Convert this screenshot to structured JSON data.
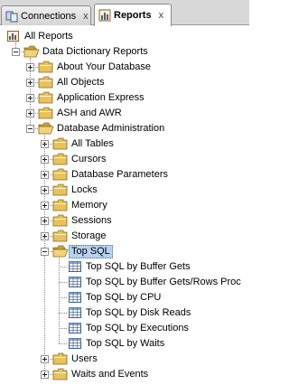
{
  "tabs": [
    {
      "label": "Connections",
      "close": "x",
      "icon": "connections-icon",
      "active": false
    },
    {
      "label": "Reports",
      "close": "x",
      "icon": "reports-icon",
      "active": true
    }
  ],
  "tree": [
    {
      "label": "All Reports",
      "depth": 0,
      "expander": "none",
      "icon": "reports-root-icon"
    },
    {
      "label": "Data Dictionary Reports",
      "depth": 1,
      "expander": "minus",
      "icon": "folder-open-icon"
    },
    {
      "label": "About Your Database",
      "depth": 2,
      "expander": "plus",
      "icon": "folder-icon"
    },
    {
      "label": "All Objects",
      "depth": 2,
      "expander": "plus",
      "icon": "folder-icon"
    },
    {
      "label": "Application Express",
      "depth": 2,
      "expander": "plus",
      "icon": "folder-icon"
    },
    {
      "label": "ASH and AWR",
      "depth": 2,
      "expander": "plus",
      "icon": "folder-icon"
    },
    {
      "label": "Database Administration",
      "depth": 2,
      "expander": "minus",
      "icon": "folder-open-icon"
    },
    {
      "label": "All Tables",
      "depth": 3,
      "expander": "plus",
      "icon": "folder-icon"
    },
    {
      "label": "Cursors",
      "depth": 3,
      "expander": "plus",
      "icon": "folder-icon"
    },
    {
      "label": "Database Parameters",
      "depth": 3,
      "expander": "plus",
      "icon": "folder-icon"
    },
    {
      "label": "Locks",
      "depth": 3,
      "expander": "plus",
      "icon": "folder-icon"
    },
    {
      "label": "Memory",
      "depth": 3,
      "expander": "plus",
      "icon": "folder-icon"
    },
    {
      "label": "Sessions",
      "depth": 3,
      "expander": "plus",
      "icon": "folder-icon"
    },
    {
      "label": "Storage",
      "depth": 3,
      "expander": "plus",
      "icon": "folder-icon"
    },
    {
      "label": "Top SQL",
      "depth": 3,
      "expander": "minus",
      "icon": "folder-open-icon",
      "selected": true
    },
    {
      "label": "Top SQL by Buffer Gets",
      "depth": 4,
      "expander": "none",
      "icon": "report-grid-icon"
    },
    {
      "label": "Top SQL by Buffer Gets/Rows Proc",
      "depth": 4,
      "expander": "none",
      "icon": "report-grid-icon"
    },
    {
      "label": "Top SQL by CPU",
      "depth": 4,
      "expander": "none",
      "icon": "report-grid-icon"
    },
    {
      "label": "Top SQL by Disk Reads",
      "depth": 4,
      "expander": "none",
      "icon": "report-grid-icon"
    },
    {
      "label": "Top SQL by Executions",
      "depth": 4,
      "expander": "none",
      "icon": "report-grid-icon"
    },
    {
      "label": "Top SQL by Waits",
      "depth": 4,
      "expander": "none",
      "icon": "report-grid-icon"
    },
    {
      "label": "Users",
      "depth": 3,
      "expander": "plus",
      "icon": "folder-icon"
    },
    {
      "label": "Waits and Events",
      "depth": 3,
      "expander": "plus",
      "icon": "folder-icon"
    }
  ],
  "colors": {
    "selection": "#b6d2ef",
    "folder": "#e9c25a",
    "tab_strip": "#d8d8d8"
  }
}
